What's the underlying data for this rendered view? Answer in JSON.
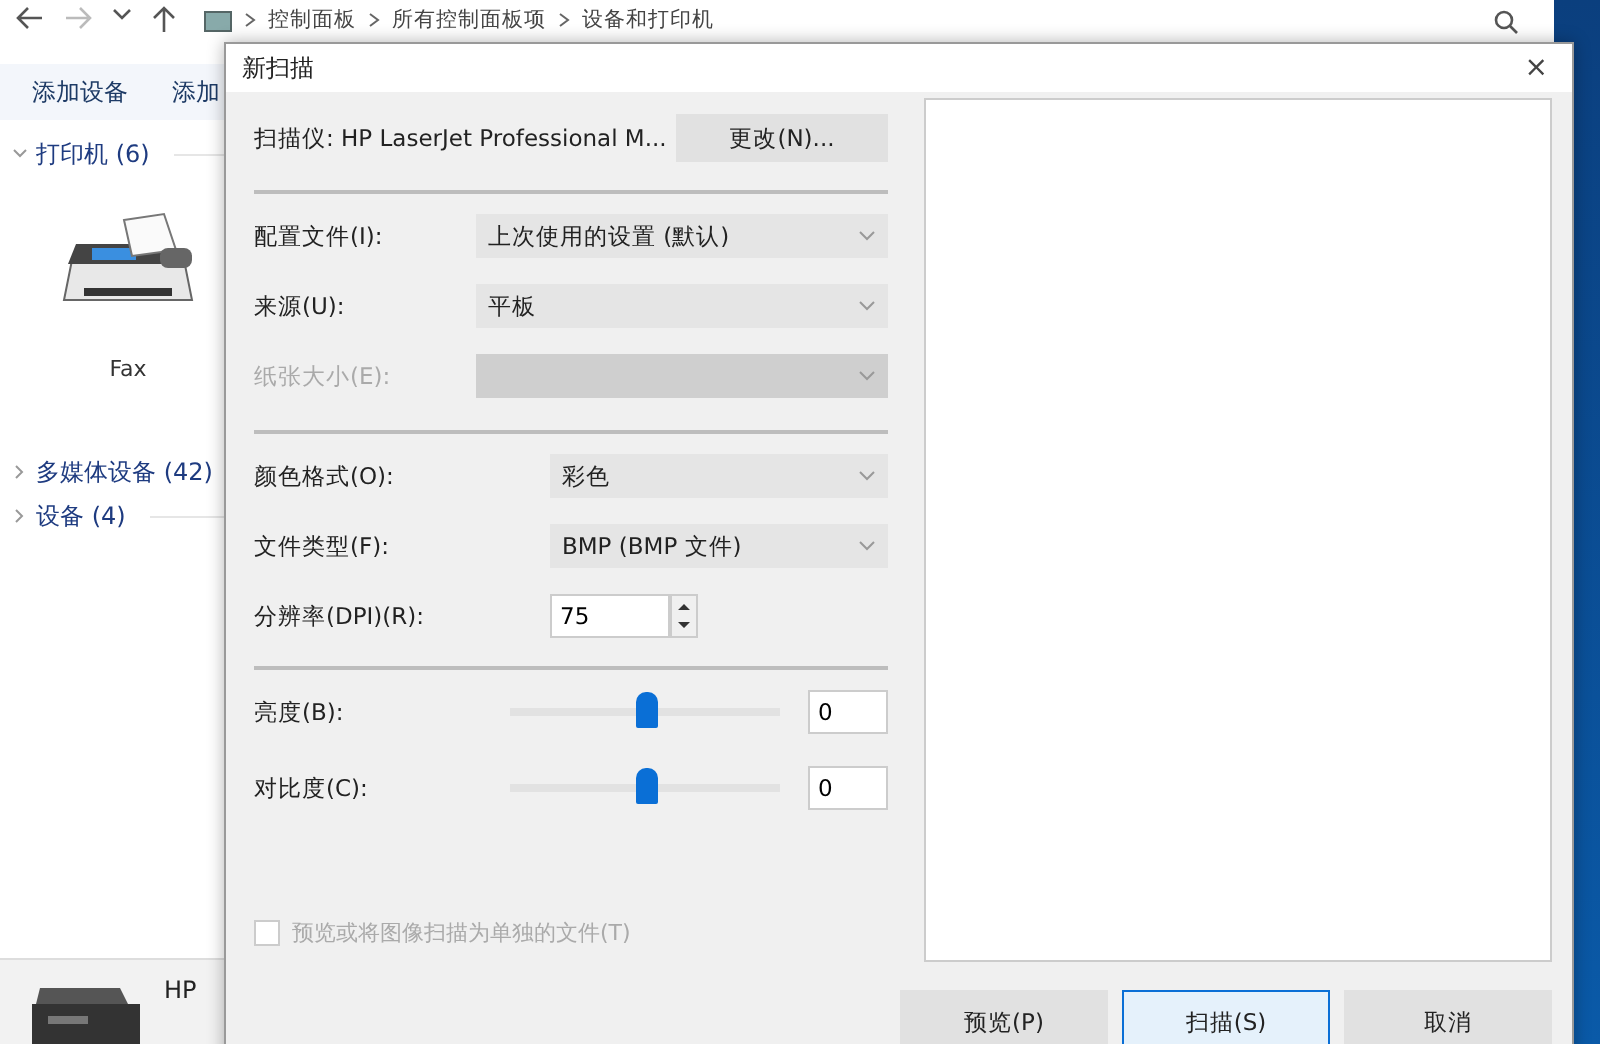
{
  "explorer": {
    "nav_path": [
      "控制面板",
      "所有控制面板项",
      "设备和打印机"
    ],
    "toolbar": [
      "添加设备",
      "添加"
    ],
    "groups": [
      {
        "label": "打印机 (6)",
        "expanded": true,
        "items": [
          {
            "label": "Fax"
          }
        ]
      },
      {
        "label": "多媒体设备 (42)",
        "expanded": false
      },
      {
        "label": "设备 (4)",
        "expanded": false
      }
    ],
    "details": {
      "label": "HP"
    }
  },
  "dialog": {
    "title": "新扫描",
    "close": "×",
    "scanner": {
      "label": "扫描仪: HP LaserJet Professional M...",
      "button": "更改(N)..."
    },
    "sections": [
      [
        {
          "kind": "select",
          "label": "配置文件(I):",
          "value": "上次使用的设置 (默认)",
          "disabled": false
        },
        {
          "kind": "select",
          "label": "来源(U):",
          "value": "平板",
          "disabled": false
        },
        {
          "kind": "select",
          "label": "纸张大小(E):",
          "disabled": true
        }
      ],
      [
        {
          "kind": "select",
          "label": "颜色格式(O):",
          "value": "彩色",
          "disabled": false
        },
        {
          "kind": "select",
          "label": "文件类型(F):",
          "value": "BMP (BMP 文件)",
          "disabled": false
        },
        {
          "kind": "spin",
          "label": "分辨率(DPI)(R):",
          "value": "75"
        }
      ],
      [
        {
          "kind": "slider",
          "label": "亮度(B):",
          "level": 0.5,
          "value": "0"
        },
        {
          "kind": "slider",
          "label": "对比度(C):",
          "level": 0.5,
          "value": "0"
        }
      ]
    ],
    "checkbox": {
      "label": "预览或将图像扫描为单独的文件(T)",
      "checked": false,
      "disabled": true
    },
    "buttons": [
      {
        "label": "预览(P)",
        "focused": false
      },
      {
        "label": "扫描(S)",
        "focused": true
      },
      {
        "label": "取消",
        "focused": false
      }
    ]
  }
}
